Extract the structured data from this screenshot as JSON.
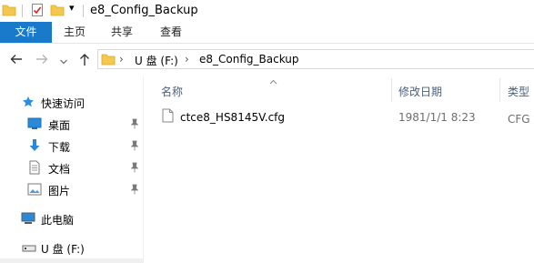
{
  "title_bar": {
    "title": "e8_Config_Backup",
    "qa_dropdown_glyph": "▾"
  },
  "ribbon": {
    "tabs": [
      {
        "label": "文件",
        "active": true
      },
      {
        "label": "主页"
      },
      {
        "label": "共享"
      },
      {
        "label": "查看"
      }
    ]
  },
  "address_bar": {
    "crumbs": [
      "U 盘 (F:)",
      "e8_Config_Backup"
    ],
    "separator": "›"
  },
  "nav_pane": {
    "quick_access_label": "快速访问",
    "quick_items": [
      {
        "label": "桌面",
        "icon": "desktop-icon"
      },
      {
        "label": "下载",
        "icon": "download-icon"
      },
      {
        "label": "文档",
        "icon": "document-icon"
      },
      {
        "label": "图片",
        "icon": "pictures-icon"
      }
    ],
    "this_pc_label": "此电脑",
    "drive_label": "U 盘 (F:)"
  },
  "columns": {
    "name": "名称",
    "modified": "修改日期",
    "type": "类型"
  },
  "files": [
    {
      "name": "ctce8_HS8145V.cfg",
      "modified": "1981/1/1 8:23",
      "type": "CFG 文"
    }
  ],
  "colors": {
    "accent": "#1979ca",
    "header_text": "#4c607a",
    "meta_text": "#6d6d6d"
  }
}
